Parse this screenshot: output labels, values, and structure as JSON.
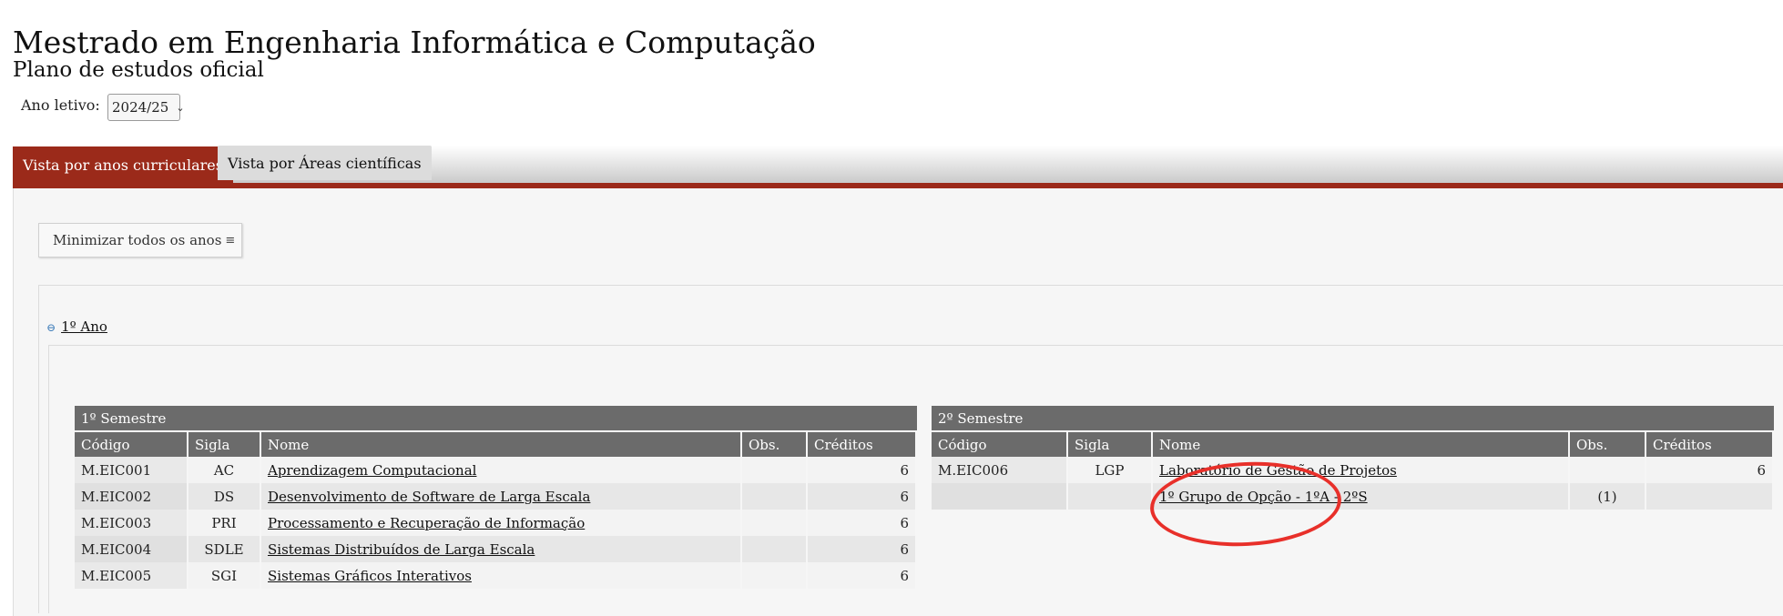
{
  "header": {
    "title": "Mestrado em Engenharia Informática e Computação",
    "subtitle": "Plano de estudos oficial",
    "year_label": "Ano letivo:",
    "year_value": "2024/25"
  },
  "tabs": [
    {
      "label": "Vista por anos curriculares",
      "active": true
    },
    {
      "label": "Vista por Áreas científicas",
      "active": false
    }
  ],
  "toolbar": {
    "minimize_label": "Minimizar todos os anos",
    "minimize_icon": "collapse-icon"
  },
  "year_section": {
    "toggle_label": "1º Ano",
    "toggle_icon": "minus-circle-icon"
  },
  "columns": [
    "Código",
    "Sigla",
    "Nome",
    "Obs.",
    "Créditos"
  ],
  "semesters": [
    {
      "title": "1º Semestre",
      "rows": [
        {
          "code": "M.EIC001",
          "sigla": "AC",
          "name": "Aprendizagem Computacional",
          "obs": "",
          "credits": "6"
        },
        {
          "code": "M.EIC002",
          "sigla": "DS",
          "name": "Desenvolvimento de Software de Larga Escala",
          "obs": "",
          "credits": "6"
        },
        {
          "code": "M.EIC003",
          "sigla": "PRI",
          "name": "Processamento e Recuperação de Informação",
          "obs": "",
          "credits": "6"
        },
        {
          "code": "M.EIC004",
          "sigla": "SDLE",
          "name": "Sistemas Distribuídos de Larga Escala",
          "obs": "",
          "credits": "6"
        },
        {
          "code": "M.EIC005",
          "sigla": "SGI",
          "name": "Sistemas Gráficos Interativos",
          "obs": "",
          "credits": "6"
        }
      ]
    },
    {
      "title": "2º Semestre",
      "rows": [
        {
          "code": "M.EIC006",
          "sigla": "LGP",
          "name": "Laboratório de Gestão de Projetos",
          "obs": "",
          "credits": "6"
        },
        {
          "code": "",
          "sigla": "",
          "name": "1º Grupo de Opção - 1ºA - 2ºS",
          "obs": "(1)",
          "credits": ""
        }
      ]
    }
  ],
  "colors": {
    "accent": "#9b2a1a",
    "header_gray": "#6b6b6b",
    "annotation_red": "#e8302a"
  }
}
